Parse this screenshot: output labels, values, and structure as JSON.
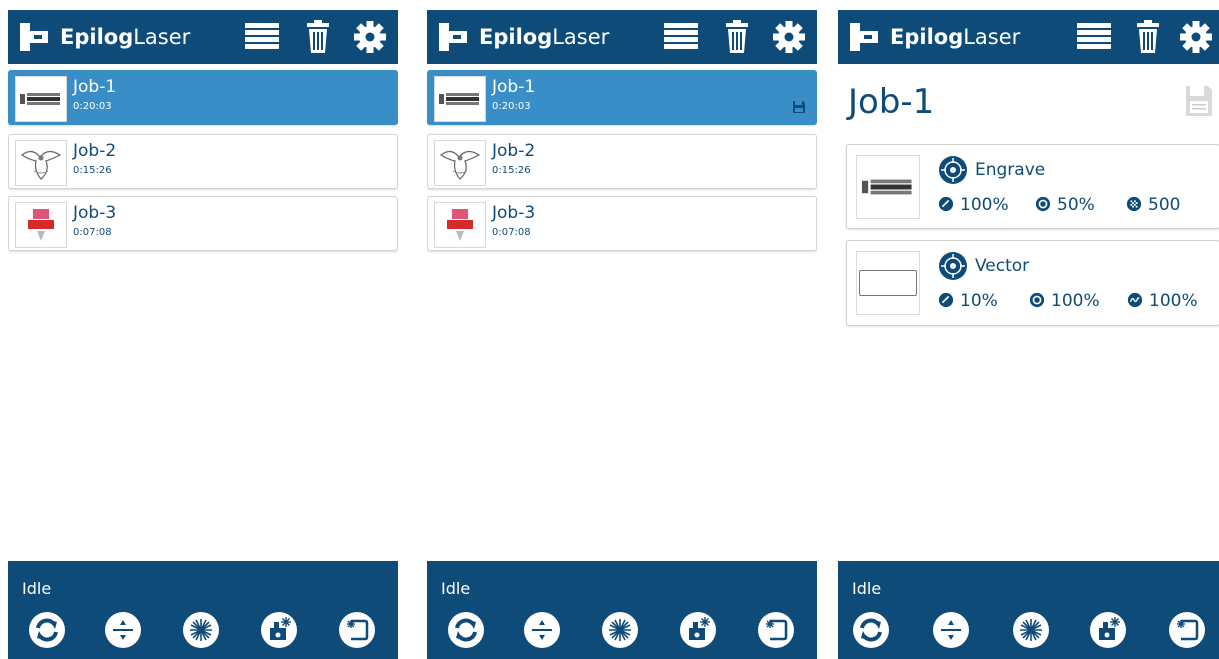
{
  "brand": {
    "bold": "Epilog",
    "light": "Laser"
  },
  "header_icons": [
    "job-list-icon",
    "trash-icon",
    "gear-icon"
  ],
  "colors": {
    "primary": "#0f4b79",
    "selected": "#3a8ec8",
    "border": "#d4d4d4"
  },
  "jobs": [
    {
      "name": "Job-1",
      "time": "0:20:03"
    },
    {
      "name": "Job-2",
      "time": "0:15:26"
    },
    {
      "name": "Job-3",
      "time": "0:07:08"
    }
  ],
  "footer": {
    "status": "Idle",
    "buttons": [
      "refresh-icon",
      "focus-icon",
      "laser-fire-icon",
      "jog-icon",
      "home-icon"
    ]
  },
  "detail": {
    "title": "Job-1",
    "engrave": {
      "label": "Engrave",
      "speed": "100%",
      "power": "50%",
      "resolution": "500"
    },
    "vector": {
      "label": "Vector",
      "speed": "10%",
      "power": "100%",
      "frequency": "100%"
    }
  }
}
